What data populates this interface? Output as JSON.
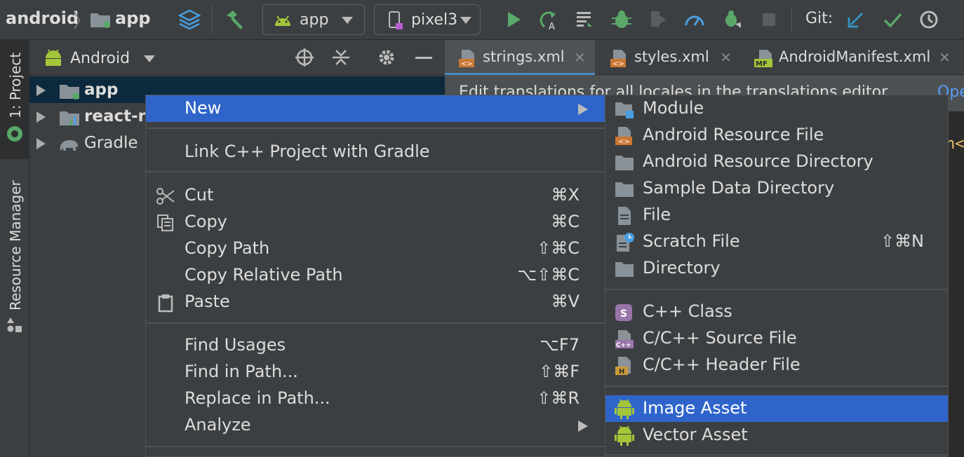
{
  "toolbar": {
    "breadcrumb_project": "android",
    "breadcrumb_module": "app",
    "run_config": "app",
    "device": "pixel3",
    "git_label": "Git:"
  },
  "side_strip": {
    "project_tab": "1: Project",
    "resource_manager_tab": "Resource Manager"
  },
  "project_panel": {
    "view_mode": "Android",
    "tree": [
      {
        "label": "app",
        "selected": true
      },
      {
        "label": "react-n",
        "selected": false
      },
      {
        "label": "Gradle",
        "selected": false
      }
    ]
  },
  "editor": {
    "tabs": [
      {
        "label": "strings.xml",
        "active": true
      },
      {
        "label": "styles.xml",
        "active": false
      },
      {
        "label": "AndroidManifest.xml",
        "active": false
      }
    ],
    "notice_text": "Edit translations for all locales in the translations editor.",
    "notice_link": "Ope",
    "code_fragment": "n<"
  },
  "context_menu": {
    "items": {
      "new": {
        "label": "New",
        "shortcut": ""
      },
      "link_cpp": {
        "label": "Link C++ Project with Gradle",
        "shortcut": ""
      },
      "cut": {
        "label": "Cut",
        "shortcut": "⌘X"
      },
      "copy": {
        "label": "Copy",
        "shortcut": "⌘C"
      },
      "copy_path": {
        "label": "Copy Path",
        "shortcut": "⇧⌘C"
      },
      "copy_relative_path": {
        "label": "Copy Relative Path",
        "shortcut": "⌥⇧⌘C"
      },
      "paste": {
        "label": "Paste",
        "shortcut": "⌘V"
      },
      "find_usages": {
        "label": "Find Usages",
        "shortcut": "⌥F7"
      },
      "find_in_path": {
        "label": "Find in Path...",
        "shortcut": "⇧⌘F"
      },
      "replace_in_path": {
        "label": "Replace in Path...",
        "shortcut": "⇧⌘R"
      },
      "analyze": {
        "label": "Analyze",
        "shortcut": ""
      }
    }
  },
  "new_submenu": {
    "items": {
      "module": {
        "label": "Module",
        "shortcut": ""
      },
      "android_resource_file": {
        "label": "Android Resource File",
        "shortcut": ""
      },
      "android_resource_directory": {
        "label": "Android Resource Directory",
        "shortcut": ""
      },
      "sample_data_directory": {
        "label": "Sample Data Directory",
        "shortcut": ""
      },
      "file": {
        "label": "File",
        "shortcut": ""
      },
      "scratch_file": {
        "label": "Scratch File",
        "shortcut": "⇧⌘N"
      },
      "directory": {
        "label": "Directory",
        "shortcut": ""
      },
      "cpp_class": {
        "label": "C++ Class",
        "shortcut": ""
      },
      "cpp_source": {
        "label": "C/C++ Source File",
        "shortcut": ""
      },
      "cpp_header": {
        "label": "C/C++ Header File",
        "shortcut": ""
      },
      "image_asset": {
        "label": "Image Asset",
        "shortcut": ""
      },
      "vector_asset": {
        "label": "Vector Asset",
        "shortcut": ""
      }
    }
  },
  "colors": {
    "selection": "#2f65ca",
    "run_green": "#59a869",
    "android_green": "#a4c639",
    "git_blue": "#3592c4"
  }
}
